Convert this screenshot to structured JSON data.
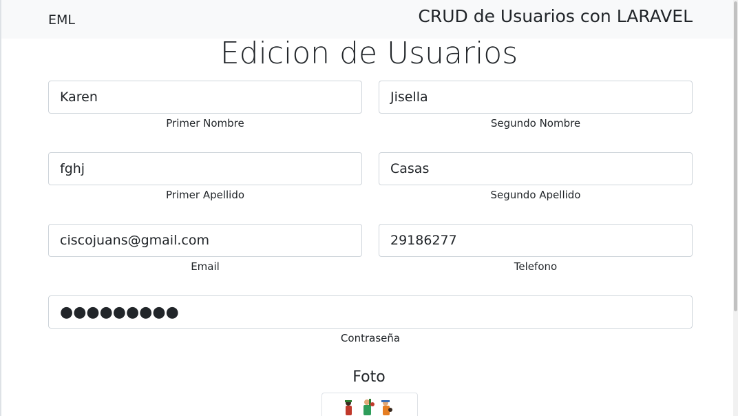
{
  "navbar": {
    "brand": "EML",
    "title": "CRUD de Usuarios con LARAVEL"
  },
  "page": {
    "title": "Edicion de Usuarios"
  },
  "form": {
    "primer_nombre": {
      "value": "Karen",
      "label": "Primer Nombre"
    },
    "segundo_nombre": {
      "value": "Jisella",
      "label": "Segundo Nombre"
    },
    "primer_apellido": {
      "value": "fghj",
      "label": "Primer Apellido"
    },
    "segundo_apellido": {
      "value": "Casas",
      "label": "Segundo Apellido"
    },
    "email": {
      "value": "ciscojuans@gmail.com",
      "label": "Email"
    },
    "telefono": {
      "value": "29186277",
      "label": "Telefono"
    },
    "contrasena": {
      "value": "●●●●●●●●●",
      "label": "Contraseña"
    }
  },
  "foto": {
    "title": "Foto",
    "image": "user-photo-illustration"
  }
}
